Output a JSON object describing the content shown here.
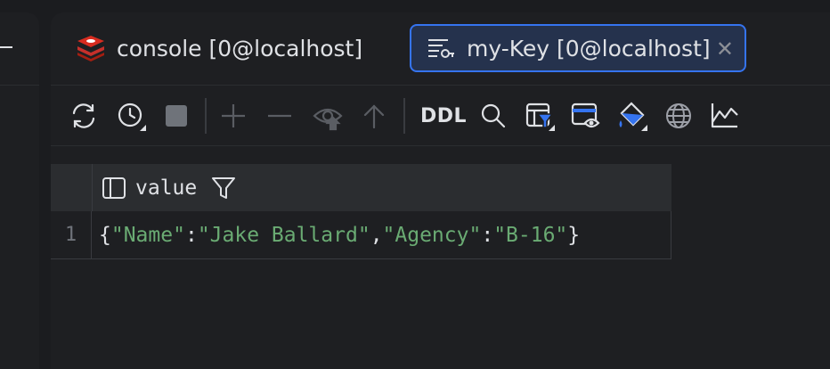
{
  "tabs": [
    {
      "label": "console [0@localhost]",
      "icon": "redis-icon",
      "active": false
    },
    {
      "label": "my-Key [0@localhost]",
      "icon": "key-value-icon",
      "active": true,
      "close_glyph": "✕"
    }
  ],
  "toolbar": {
    "ddl_label": "DDL",
    "icons": [
      "refresh-icon",
      "history-icon",
      "stop-icon",
      "add-icon",
      "remove-icon",
      "view-icon",
      "submit-icon",
      "search-icon",
      "filter-icon",
      "view-mode-icon",
      "color-fill-icon",
      "globe-icon",
      "chart-icon"
    ]
  },
  "grid": {
    "column": "value",
    "rows": [
      {
        "num": "1",
        "value": "{\"Name\":\"Jake Ballard\",\"Agency\":\"B-16\"}"
      }
    ]
  },
  "colors": {
    "accent": "#3574f0",
    "active_tab_bg": "#25324d",
    "string": "#6aab73",
    "background": "#1e1f22"
  }
}
